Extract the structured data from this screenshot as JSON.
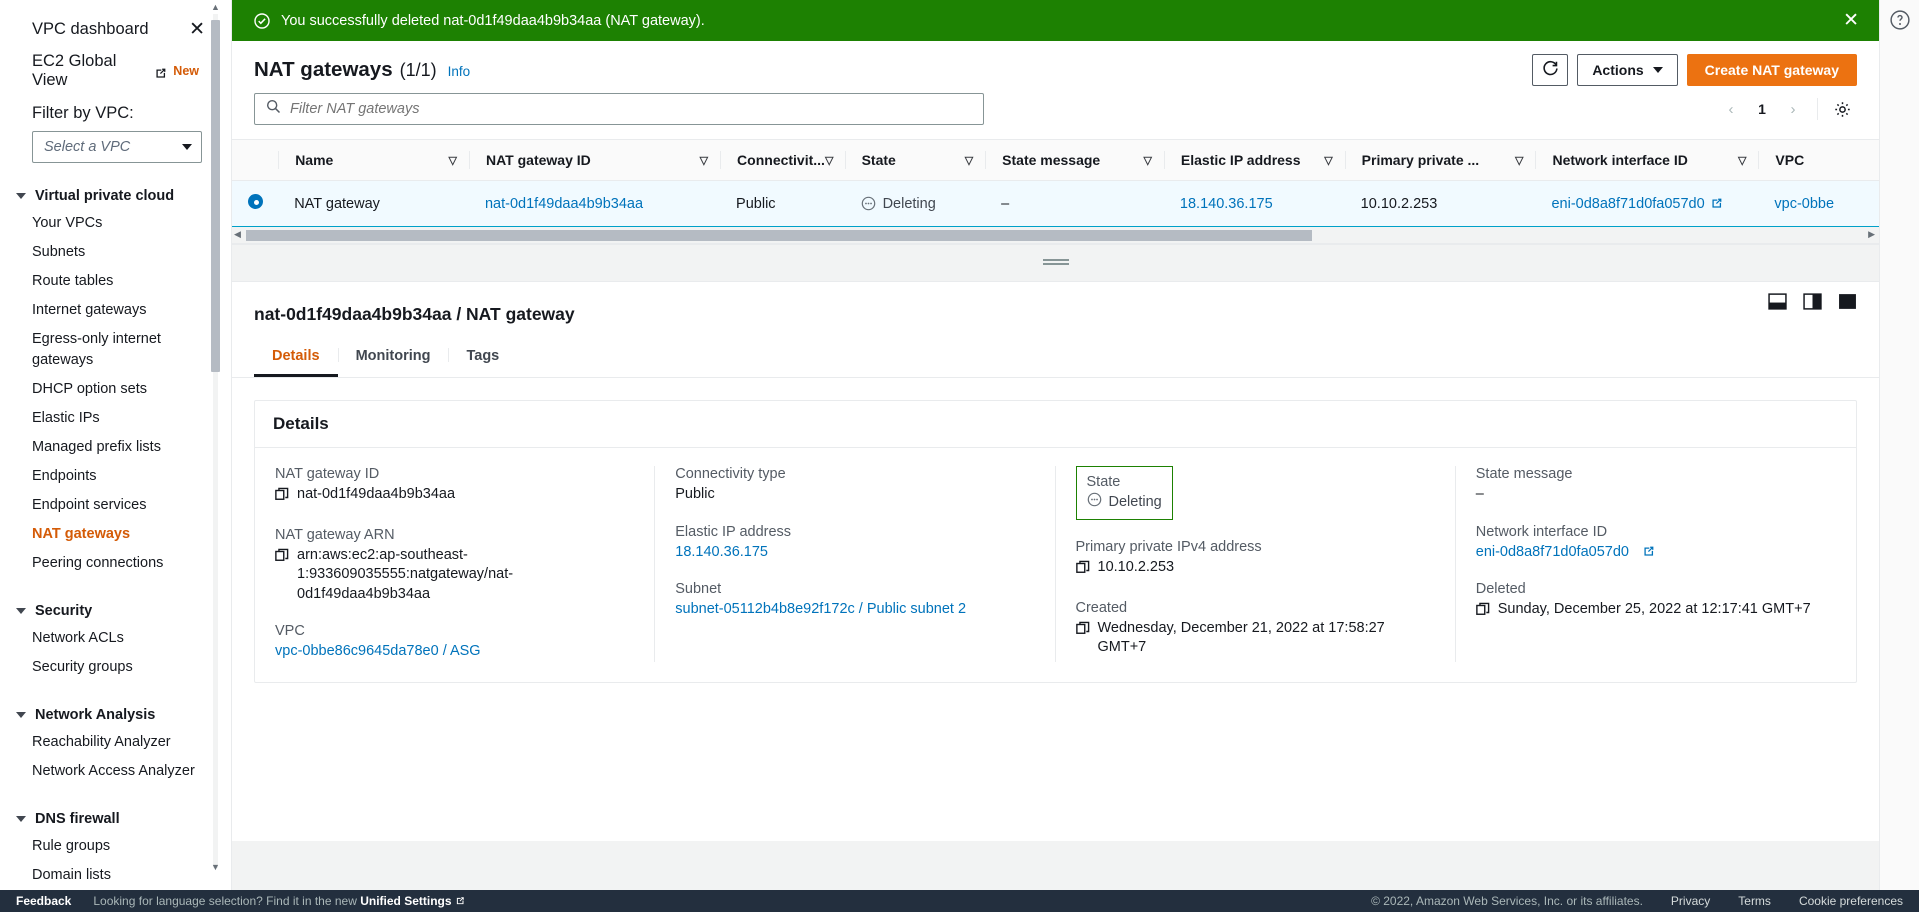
{
  "sidebar": {
    "title": "VPC dashboard",
    "close_icon": "close-icon",
    "global_view": {
      "label": "EC2 Global View",
      "badge": "New"
    },
    "filter_label": "Filter by VPC:",
    "vpc_select_value": "Select a VPC",
    "groups": [
      {
        "label": "Virtual private cloud",
        "items": [
          "Your VPCs",
          "Subnets",
          "Route tables",
          "Internet gateways",
          "Egress-only internet gateways",
          "DHCP option sets",
          "Elastic IPs",
          "Managed prefix lists",
          "Endpoints",
          "Endpoint services",
          "NAT gateways",
          "Peering connections"
        ],
        "selected": "NAT gateways"
      },
      {
        "label": "Security",
        "items": [
          "Network ACLs",
          "Security groups"
        ],
        "selected": ""
      },
      {
        "label": "Network Analysis",
        "items": [
          "Reachability Analyzer",
          "Network Access Analyzer"
        ],
        "selected": ""
      },
      {
        "label": "DNS firewall",
        "items": [
          "Rule groups",
          "Domain lists"
        ],
        "selected": ""
      }
    ]
  },
  "flash": {
    "icon": "success-check-icon",
    "message": "You successfully deleted nat-0d1f49daa4b9b34aa (NAT gateway).",
    "close_icon": "close-icon",
    "bg_color": "#1d8102"
  },
  "table_panel": {
    "title": "NAT gateways",
    "count": "(1/1)",
    "info_label": "Info",
    "refresh_icon": "refresh-icon",
    "actions_label": "Actions",
    "create_label": "Create NAT gateway",
    "primary_color": "#ec7211",
    "search_placeholder": "Filter NAT gateways",
    "search_value": "",
    "search_icon": "search-icon",
    "pagination": {
      "prev": "‹",
      "page": "1",
      "next": "›"
    },
    "settings_icon": "gear-icon",
    "columns": [
      "Name",
      "NAT gateway ID",
      "Connectivit...",
      "State",
      "State message",
      "Elastic IP address",
      "Primary private ...",
      "Network interface ID",
      "VPC"
    ],
    "rows": [
      {
        "selected": true,
        "name": "NAT gateway",
        "nat_gateway_id": "nat-0d1f49daa4b9b34aa",
        "connectivity": "Public",
        "state": "Deleting",
        "state_message": "–",
        "elastic_ip": "18.140.36.175",
        "primary_private_ip": "10.10.2.253",
        "network_interface_id": "eni-0d8a8f71d0fa057d0",
        "vpc": "vpc-0bbe"
      }
    ]
  },
  "detail": {
    "title": "nat-0d1f49daa4b9b34aa / NAT gateway",
    "tabs": [
      {
        "label": "Details",
        "active": true
      },
      {
        "label": "Monitoring",
        "active": false
      },
      {
        "label": "Tags",
        "active": false
      }
    ],
    "section_title": "Details",
    "fields": {
      "nat_gateway_id": {
        "label": "NAT gateway ID",
        "value": "nat-0d1f49daa4b9b34aa"
      },
      "nat_gateway_arn": {
        "label": "NAT gateway ARN",
        "value": "arn:aws:ec2:ap-southeast-1:933609035555:natgateway/nat-0d1f49daa4b9b34aa"
      },
      "vpc": {
        "label": "VPC",
        "value": "vpc-0bbe86c9645da78e0 / ASG"
      },
      "connectivity_type": {
        "label": "Connectivity type",
        "value": "Public"
      },
      "elastic_ip": {
        "label": "Elastic IP address",
        "value": "18.140.36.175"
      },
      "subnet": {
        "label": "Subnet",
        "value": "subnet-05112b4b8e92f172c / Public subnet 2"
      },
      "state": {
        "label": "State",
        "value": "Deleting"
      },
      "primary_private_ipv4": {
        "label": "Primary private IPv4 address",
        "value": "10.10.2.253"
      },
      "created": {
        "label": "Created",
        "value": "Wednesday, December 21, 2022 at 17:58:27 GMT+7"
      },
      "state_message": {
        "label": "State message",
        "value": "–"
      },
      "network_interface_id": {
        "label": "Network interface ID",
        "value": "eni-0d8a8f71d0fa057d0"
      },
      "deleted": {
        "label": "Deleted",
        "value": "Sunday, December 25, 2022 at 12:17:41 GMT+7"
      }
    },
    "panel_icons": [
      "split-panel-bottom-icon",
      "split-panel-side-icon",
      "split-panel-full-icon"
    ]
  },
  "footer": {
    "feedback": "Feedback",
    "language_note": "Looking for language selection? Find it in the new",
    "unified_settings": "Unified Settings",
    "copyright": "© 2022, Amazon Web Services, Inc. or its affiliates.",
    "privacy": "Privacy",
    "terms": "Terms",
    "cookie_prefs": "Cookie preferences",
    "bg_color": "#232f3e"
  },
  "rail": {
    "help_icon": "help-info-icon"
  }
}
